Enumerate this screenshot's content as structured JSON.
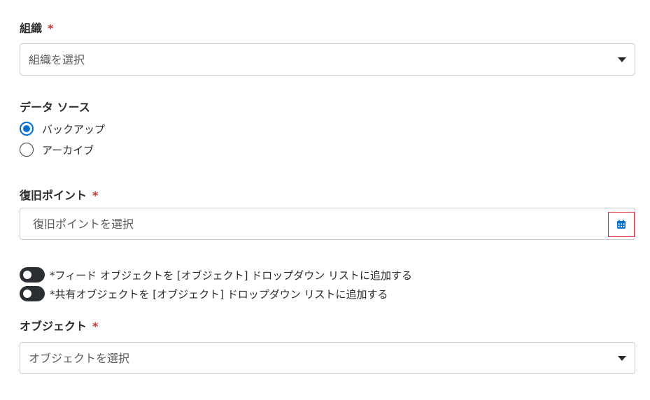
{
  "organization": {
    "label": "組織",
    "required_mark": "*",
    "placeholder": "組織を選択"
  },
  "data_source": {
    "label": "データ ソース",
    "options": [
      {
        "label": "バックアップ",
        "selected": true
      },
      {
        "label": "アーカイブ",
        "selected": false
      }
    ]
  },
  "restore_point": {
    "label": "復旧ポイント",
    "required_mark": "*",
    "placeholder": "復旧ポイントを選択",
    "icon": "calendar-icon"
  },
  "toggles": [
    {
      "label": "*フィード オブジェクトを [オブジェクト] ドロップダウン リストに追加する",
      "on": true
    },
    {
      "label": "*共有オブジェクトを [オブジェクト] ドロップダウン リストに追加する",
      "on": true
    }
  ],
  "object": {
    "label": "オブジェクト",
    "required_mark": "*",
    "placeholder": "オブジェクトを選択"
  },
  "colors": {
    "accent": "#0070d2",
    "required": "#c23934",
    "toggle": "#2b2f33",
    "focus_border": "#e0323a"
  }
}
